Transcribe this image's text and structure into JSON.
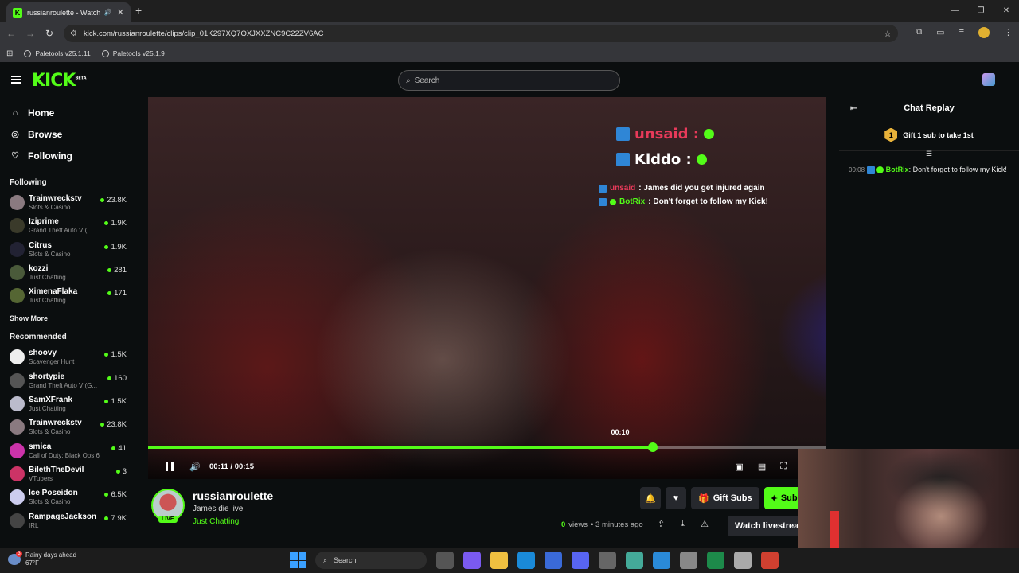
{
  "browser": {
    "tab_title": "russianroulette - Watch clip",
    "tab_favicon": "K",
    "url": "kick.com/russianroulette/clips/clip_01K297XQ7QXJXXZNC9C22ZV6AC",
    "bookmarks": [
      "Paletools v25.1.11",
      "Paletools v25.1.9"
    ]
  },
  "header": {
    "logo": "KICK",
    "logo_badge": "BETA",
    "search_placeholder": "Search"
  },
  "sidebar": {
    "nav": [
      {
        "label": "Home",
        "icon": "home-icon"
      },
      {
        "label": "Browse",
        "icon": "compass-icon"
      },
      {
        "label": "Following",
        "icon": "heart-icon"
      }
    ],
    "following_title": "Following",
    "following": [
      {
        "name": "Trainwreckstv",
        "category": "Slots & Casino",
        "viewers": "23.8K",
        "color": "#8a7a80"
      },
      {
        "name": "Iziprime",
        "category": "Grand Theft Auto V (...",
        "viewers": "1.9K",
        "color": "#3a3a2a"
      },
      {
        "name": "Citrus",
        "category": "Slots & Casino",
        "viewers": "1.9K",
        "color": "#222233"
      },
      {
        "name": "kozzi",
        "category": "Just Chatting",
        "viewers": "281",
        "color": "#4a5a3a"
      },
      {
        "name": "XimenaFlaka",
        "category": "Just Chatting",
        "viewers": "171",
        "color": "#556633"
      }
    ],
    "show_more": "Show More",
    "recommended_title": "Recommended",
    "recommended": [
      {
        "name": "shoovy",
        "category": "Scavenger Hunt",
        "viewers": "1.5K",
        "color": "#eeeeee"
      },
      {
        "name": "shortypie",
        "category": "Grand Theft Auto V (G...",
        "viewers": "160",
        "color": "#555555"
      },
      {
        "name": "SamXFrank",
        "category": "Just Chatting",
        "viewers": "1.5K",
        "color": "#bbbbcc"
      },
      {
        "name": "Trainwreckstv",
        "category": "Slots & Casino",
        "viewers": "23.8K",
        "color": "#8a7a80"
      },
      {
        "name": "smica",
        "category": "Call of Duty: Black Ops 6",
        "viewers": "41",
        "color": "#cc33aa"
      },
      {
        "name": "BilethTheDevil",
        "category": "VTubers",
        "viewers": "3",
        "color": "#cc3366"
      },
      {
        "name": "Ice Poseidon",
        "category": "Slots & Casino",
        "viewers": "6.5K",
        "color": "#ccccee"
      },
      {
        "name": "RampageJackson",
        "category": "IRL",
        "viewers": "7.9K",
        "color": "#444444"
      }
    ]
  },
  "video": {
    "overlay_user1": "unsaid :",
    "overlay_user2": "Klddo :",
    "overlay_chat1_user": "unsaid",
    "overlay_chat1_text": ": James did you get injured again",
    "overlay_chat2_user": "BotRix",
    "overlay_chat2_text": ": Don't forget to follow my Kick!",
    "current_time": "00:11",
    "duration": "00:15",
    "time_separator": "/",
    "hover_time": "00:10",
    "progress": 0.744,
    "hover_position": 0.696
  },
  "channel": {
    "name": "russianroulette",
    "clip_title": "James die live",
    "category": "Just Chatting",
    "live_badge": "LIVE",
    "gift_subs_label": "Gift Subs",
    "subscribe_label": "Subscribe",
    "views": "0",
    "views_label": "views",
    "posted": "• 3 minutes ago",
    "watch_livestream_label": "Watch livestream"
  },
  "chat": {
    "title": "Chat Replay",
    "pinned_rank": "1",
    "pinned_text": "Gift 1 sub to take 1st",
    "messages": [
      {
        "time": "00:08",
        "user": "BotRix",
        "text": ": Don't forget to follow my Kick!"
      }
    ]
  },
  "taskbar": {
    "weather_badge": "3",
    "weather_line1": "Rainy days ahead",
    "weather_line2": "67°F",
    "search_label": "Search"
  },
  "colors": {
    "accent": "#53fc18",
    "badge_blue": "#2f86d6",
    "overlay_red_name": "#e83a5a"
  }
}
